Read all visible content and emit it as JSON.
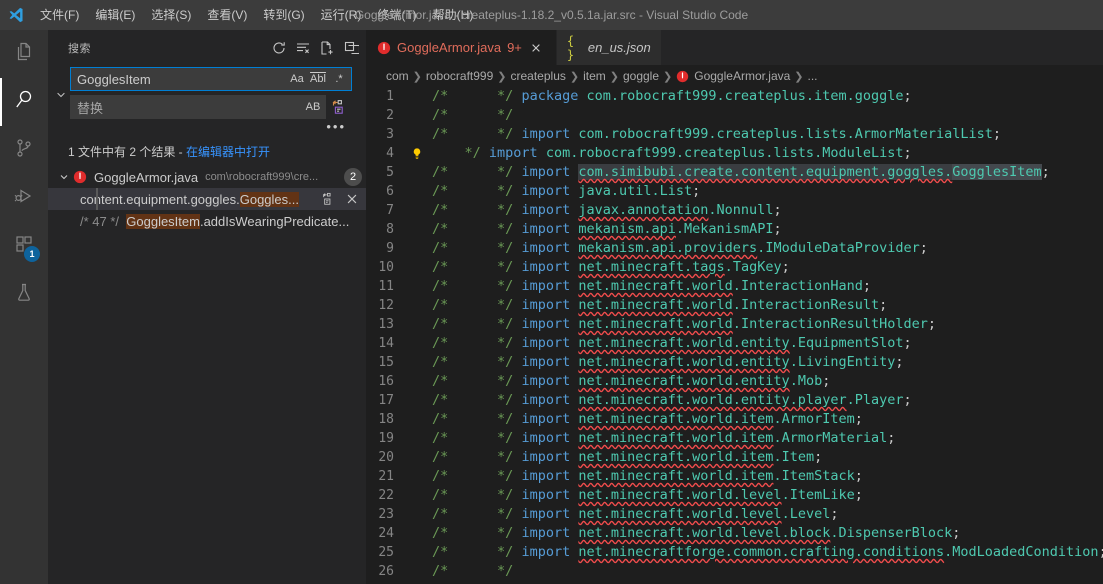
{
  "titlebar": {
    "logo_icon": "vscode-logo",
    "window_title": "GoggleArmor.java - createplus-1.18.2_v0.5.1a.jar.src - Visual Studio Code",
    "menu": [
      {
        "label": "文件(F)",
        "name": "menu-file"
      },
      {
        "label": "编辑(E)",
        "name": "menu-edit"
      },
      {
        "label": "选择(S)",
        "name": "menu-selection"
      },
      {
        "label": "查看(V)",
        "name": "menu-view"
      },
      {
        "label": "转到(G)",
        "name": "menu-go"
      },
      {
        "label": "运行(R)",
        "name": "menu-run"
      },
      {
        "label": "终端(T)",
        "name": "menu-terminal"
      },
      {
        "label": "帮助(H)",
        "name": "menu-help"
      }
    ]
  },
  "activitybar": {
    "items": [
      {
        "name": "explorer",
        "icon": "files-icon",
        "active": false,
        "badge": ""
      },
      {
        "name": "search",
        "icon": "search-icon",
        "active": true,
        "badge": ""
      },
      {
        "name": "source-control",
        "icon": "source-control-icon",
        "active": false,
        "badge": ""
      },
      {
        "name": "run-and-debug",
        "icon": "run-debug-icon",
        "active": false,
        "badge": ""
      },
      {
        "name": "extensions",
        "icon": "extensions-icon",
        "active": false,
        "badge": "1"
      },
      {
        "name": "testing",
        "icon": "beaker-icon",
        "active": false,
        "badge": ""
      }
    ]
  },
  "sidebar": {
    "title": "搜索",
    "actions": [
      {
        "name": "refresh-icon",
        "title": "刷新"
      },
      {
        "name": "clear-results-icon",
        "title": "清除搜索结果"
      },
      {
        "name": "open-new-search-editor-icon",
        "title": "在编辑器中打开新搜索"
      },
      {
        "name": "collapse-all-icon",
        "title": "全部折叠"
      }
    ],
    "search": {
      "value": "GogglesItem",
      "toggles": [
        {
          "name": "match-case-toggle",
          "label": "Aa"
        },
        {
          "name": "whole-word-toggle",
          "label": "Abl"
        },
        {
          "name": "regex-toggle",
          "label": ".*"
        }
      ]
    },
    "replace": {
      "placeholder": "替换",
      "preserve_case_label": "AB",
      "replace_all_icon": "replace-all-icon"
    },
    "details_toggle_icon": "chevron-down-icon",
    "more_actions_icon": "ellipsis-icon",
    "results_message": {
      "text": "1 文件中有 2 个结果 - ",
      "link": "在编辑器中打开"
    },
    "result_file": {
      "twisty_icon": "chevron-down-icon",
      "file_icon": "java-file-icon",
      "name": "GoggleArmor.java",
      "path": "com\\robocraft999\\cre...",
      "count": "2"
    },
    "matches": [
      {
        "name": "search-match-row-1",
        "selected": true,
        "prefix": "content.equipment.goggles.",
        "highlight": "Goggles...",
        "suffix": "",
        "line_label": "",
        "actions": [
          {
            "name": "replace-icon"
          },
          {
            "name": "dismiss-icon"
          }
        ]
      },
      {
        "name": "search-match-row-2",
        "selected": false,
        "prefix": "",
        "highlight": "GogglesItem",
        "suffix": ".addIsWearingPredicate...",
        "line_label": "/* 47 */",
        "actions": []
      }
    ]
  },
  "editor": {
    "tabs": [
      {
        "name": "tab-goggle-armor-java",
        "label": "GoggleArmor.java",
        "icon": "java-file-icon",
        "count": "9+",
        "active": true,
        "preview": false,
        "close_icon": "close-icon"
      },
      {
        "name": "tab-en-us-json",
        "label": "en_us.json",
        "icon": "json-file-icon",
        "count": "",
        "active": false,
        "preview": true,
        "close_icon": ""
      }
    ],
    "breadcrumbs": [
      {
        "label": "com",
        "icon": ""
      },
      {
        "label": "robocraft999",
        "icon": ""
      },
      {
        "label": "createplus",
        "icon": ""
      },
      {
        "label": "item",
        "icon": ""
      },
      {
        "label": "goggle",
        "icon": ""
      },
      {
        "label": "GoggleArmor.java",
        "icon": "java-file-icon"
      },
      {
        "label": "...",
        "icon": ""
      }
    ],
    "lines": [
      {
        "n": "1",
        "glyph": "",
        "comment": "/*      */",
        "kw": "package",
        "pkg": "com.robocraft999.createplus.item.goggle",
        "tail": ";",
        "squiggle": false,
        "selected": false,
        "word": ""
      },
      {
        "n": "2",
        "glyph": "",
        "comment": "/*      */",
        "kw": "",
        "pkg": "",
        "tail": "",
        "squiggle": false,
        "selected": false,
        "word": ""
      },
      {
        "n": "3",
        "glyph": "",
        "comment": "/*      */",
        "kw": "import",
        "pkg": "com.robocraft999.createplus.lists.ArmorMaterialList",
        "tail": ";",
        "squiggle": false,
        "selected": false,
        "word": ""
      },
      {
        "n": "4",
        "glyph": "lightbulb",
        "comment": "/*      */",
        "kw": "import",
        "pkg": "com.robocraft999.createplus.lists.ModuleList",
        "tail": ";",
        "squiggle": false,
        "selected": false,
        "word": ""
      },
      {
        "n": "5",
        "glyph": "",
        "comment": "/*      */",
        "kw": "import",
        "pkg": "com.simibubi.create.content.equipment.goggles.",
        "tail": ";",
        "squiggle": true,
        "selected": true,
        "word": "GogglesItem"
      },
      {
        "n": "6",
        "glyph": "",
        "comment": "/*      */",
        "kw": "import",
        "pkg": "java.util.List",
        "tail": ";",
        "squiggle": false,
        "selected": false,
        "word": ""
      },
      {
        "n": "7",
        "glyph": "",
        "comment": "/*      */",
        "kw": "import",
        "pkg": "javax.annotation.Nonnull",
        "tail": ";",
        "squiggle": true,
        "selected": false,
        "word": ""
      },
      {
        "n": "8",
        "glyph": "",
        "comment": "/*      */",
        "kw": "import",
        "pkg": "mekanism.api.MekanismAPI",
        "tail": ";",
        "squiggle": true,
        "selected": false,
        "word": ""
      },
      {
        "n": "9",
        "glyph": "",
        "comment": "/*      */",
        "kw": "import",
        "pkg": "mekanism.api.providers.IModuleDataProvider",
        "tail": ";",
        "squiggle": true,
        "selected": false,
        "word": ""
      },
      {
        "n": "10",
        "glyph": "",
        "comment": "/*      */",
        "kw": "import",
        "pkg": "net.minecraft.tags.TagKey",
        "tail": ";",
        "squiggle": true,
        "selected": false,
        "word": ""
      },
      {
        "n": "11",
        "glyph": "",
        "comment": "/*      */",
        "kw": "import",
        "pkg": "net.minecraft.world.InteractionHand",
        "tail": ";",
        "squiggle": true,
        "selected": false,
        "word": ""
      },
      {
        "n": "12",
        "glyph": "",
        "comment": "/*      */",
        "kw": "import",
        "pkg": "net.minecraft.world.InteractionResult",
        "tail": ";",
        "squiggle": true,
        "selected": false,
        "word": ""
      },
      {
        "n": "13",
        "glyph": "",
        "comment": "/*      */",
        "kw": "import",
        "pkg": "net.minecraft.world.InteractionResultHolder",
        "tail": ";",
        "squiggle": true,
        "selected": false,
        "word": ""
      },
      {
        "n": "14",
        "glyph": "",
        "comment": "/*      */",
        "kw": "import",
        "pkg": "net.minecraft.world.entity.EquipmentSlot",
        "tail": ";",
        "squiggle": true,
        "selected": false,
        "word": ""
      },
      {
        "n": "15",
        "glyph": "",
        "comment": "/*      */",
        "kw": "import",
        "pkg": "net.minecraft.world.entity.LivingEntity",
        "tail": ";",
        "squiggle": true,
        "selected": false,
        "word": ""
      },
      {
        "n": "16",
        "glyph": "",
        "comment": "/*      */",
        "kw": "import",
        "pkg": "net.minecraft.world.entity.Mob",
        "tail": ";",
        "squiggle": true,
        "selected": false,
        "word": ""
      },
      {
        "n": "17",
        "glyph": "",
        "comment": "/*      */",
        "kw": "import",
        "pkg": "net.minecraft.world.entity.player.Player",
        "tail": ";",
        "squiggle": true,
        "selected": false,
        "word": ""
      },
      {
        "n": "18",
        "glyph": "",
        "comment": "/*      */",
        "kw": "import",
        "pkg": "net.minecraft.world.item.ArmorItem",
        "tail": ";",
        "squiggle": true,
        "selected": false,
        "word": ""
      },
      {
        "n": "19",
        "glyph": "",
        "comment": "/*      */",
        "kw": "import",
        "pkg": "net.minecraft.world.item.ArmorMaterial",
        "tail": ";",
        "squiggle": true,
        "selected": false,
        "word": ""
      },
      {
        "n": "20",
        "glyph": "",
        "comment": "/*      */",
        "kw": "import",
        "pkg": "net.minecraft.world.item.Item",
        "tail": ";",
        "squiggle": true,
        "selected": false,
        "word": ""
      },
      {
        "n": "21",
        "glyph": "",
        "comment": "/*      */",
        "kw": "import",
        "pkg": "net.minecraft.world.item.ItemStack",
        "tail": ";",
        "squiggle": true,
        "selected": false,
        "word": ""
      },
      {
        "n": "22",
        "glyph": "",
        "comment": "/*      */",
        "kw": "import",
        "pkg": "net.minecraft.world.level.ItemLike",
        "tail": ";",
        "squiggle": true,
        "selected": false,
        "word": ""
      },
      {
        "n": "23",
        "glyph": "",
        "comment": "/*      */",
        "kw": "import",
        "pkg": "net.minecraft.world.level.Level",
        "tail": ";",
        "squiggle": true,
        "selected": false,
        "word": ""
      },
      {
        "n": "24",
        "glyph": "",
        "comment": "/*      */",
        "kw": "import",
        "pkg": "net.minecraft.world.level.block.DispenserBlock",
        "tail": ";",
        "squiggle": true,
        "selected": false,
        "word": ""
      },
      {
        "n": "25",
        "glyph": "",
        "comment": "/*      */",
        "kw": "import",
        "pkg": "net.minecraftforge.common.crafting.conditions.ModLoadedCondition",
        "tail": ";",
        "squiggle": true,
        "selected": false,
        "word": ""
      },
      {
        "n": "26",
        "glyph": "",
        "comment": "/*      */",
        "kw": "",
        "pkg": "",
        "tail": "",
        "squiggle": false,
        "selected": false,
        "word": ""
      }
    ]
  },
  "colors": {
    "titlebar_bg": "#3c3c3c",
    "activitybar_bg": "#333333",
    "sidebar_bg": "#252526",
    "editor_bg": "#1e1e1e",
    "accent_blue": "#007fd4",
    "link_blue": "#3794ff",
    "match_highlight": "#623315",
    "error_red": "#f14c4c",
    "comment_green": "#6a9955",
    "keyword_blue": "#569cd6",
    "type_teal": "#4ec9b0",
    "badge_blue": "#0e639c"
  }
}
